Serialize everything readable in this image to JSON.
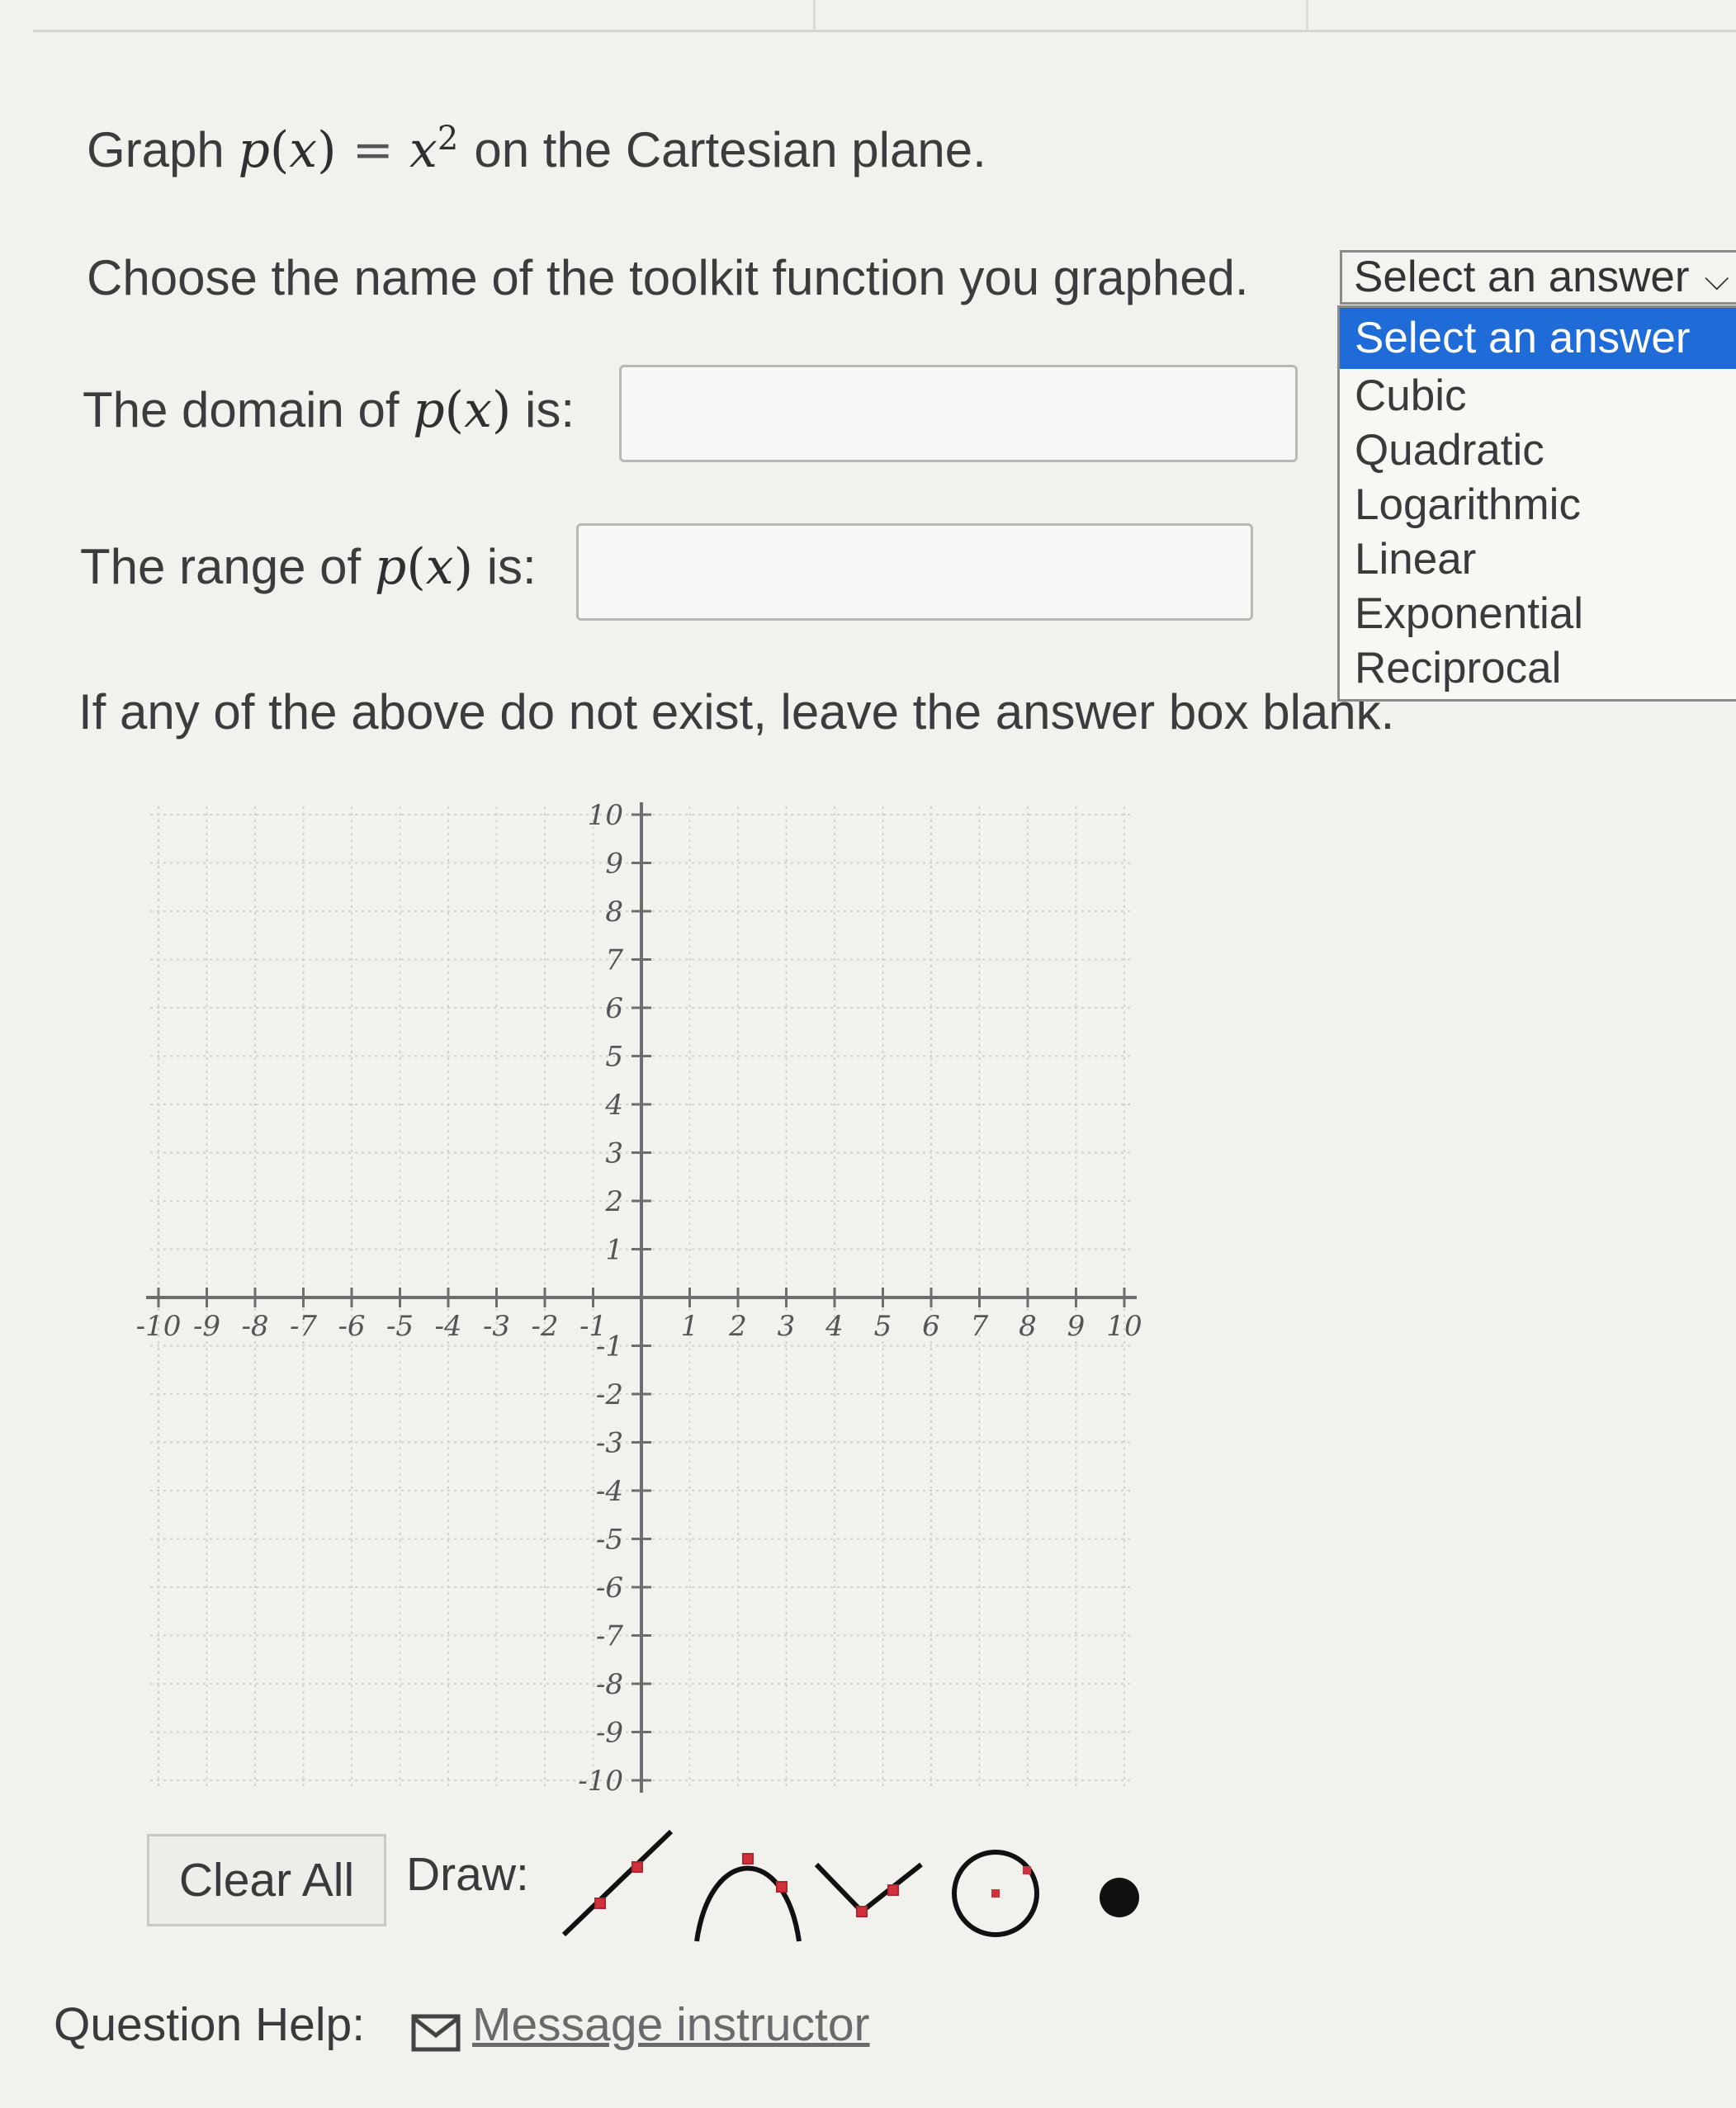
{
  "question": {
    "graph_prefix": "Graph",
    "func_name": "p",
    "func_var": "x",
    "equals": "=",
    "exponent": "2",
    "graph_suffix": "on the Cartesian plane.",
    "choose_text": "Choose the name of the toolkit function you graphed.",
    "domain_prefix": "The domain of",
    "domain_suffix": "is:",
    "range_prefix": "The range of",
    "range_suffix": "is:",
    "blank_note": "If any of the above do not exist, leave the answer box blank."
  },
  "inputs": {
    "domain_value": "",
    "range_value": ""
  },
  "dropdown": {
    "selected": "Select an answer",
    "options": [
      "Select an answer",
      "Cubic",
      "Quadratic",
      "Logarithmic",
      "Linear",
      "Exponential",
      "Reciprocal"
    ],
    "highlight_color": "#1f6bd8"
  },
  "graph": {
    "x_ticks": [
      "-10",
      "-9",
      "-8",
      "-7",
      "-6",
      "-5",
      "-4",
      "-3",
      "-2",
      "-1",
      "1",
      "2",
      "3",
      "4",
      "5",
      "6",
      "7",
      "8",
      "9",
      "10"
    ],
    "y_ticks": [
      "10",
      "9",
      "8",
      "7",
      "6",
      "5",
      "4",
      "3",
      "2",
      "1",
      "-1",
      "-2",
      "-3",
      "-4",
      "-5",
      "-6",
      "-7",
      "-8",
      "-9",
      "-10"
    ],
    "xlim": [
      -10,
      10
    ],
    "ylim": [
      -10,
      10
    ],
    "grid": true
  },
  "tools": {
    "clear_label": "Clear All",
    "draw_label": "Draw:",
    "icons": [
      "line-tool-icon",
      "parabola-down-tool-icon",
      "absolute-value-tool-icon",
      "circle-tool-icon",
      "point-tool-icon"
    ],
    "accent_color": "#d0313b"
  },
  "help": {
    "label": "Question Help:",
    "link": "Message instructor"
  }
}
